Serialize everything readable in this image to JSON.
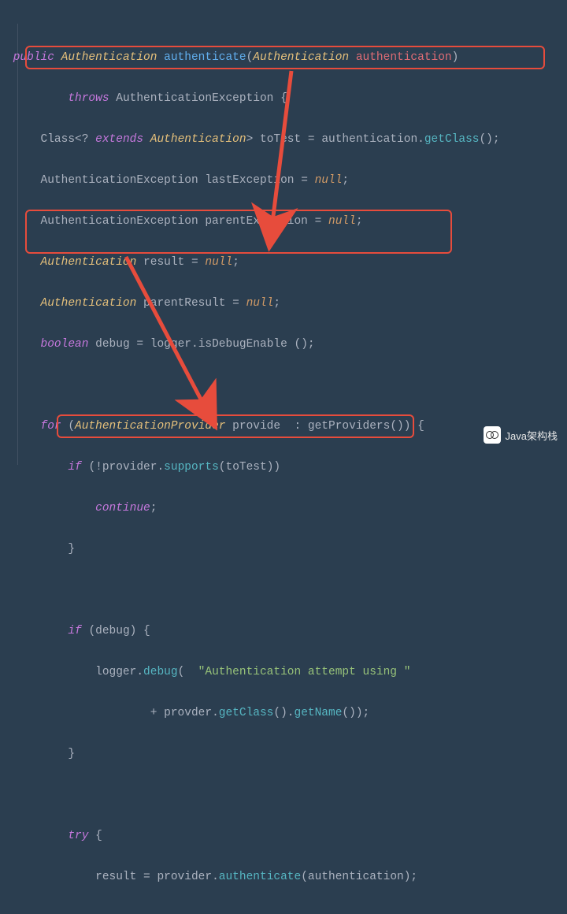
{
  "code": {
    "l1_public": "public",
    "l1_type": "Authentication",
    "l1_method": "authenticate",
    "l1_paramType": "Authentication",
    "l1_paramName": "authentication",
    "l2_throws": "throws",
    "l2_exType": "AuthenticationException",
    "l3_class": "Class",
    "l3_extends": "extends",
    "l3_authType": "Authentication",
    "l3_toTest": "toTest",
    "l3_auth": "authentication",
    "l3_getClass": "getClass",
    "l4_type": "AuthenticationException",
    "l4_var": "lastException",
    "l4_null": "null",
    "l5_type": "AuthenticationException",
    "l5_var": "parentException",
    "l5_null": "null",
    "l6_type": "Authentication",
    "l6_var": "result",
    "l6_null": "null",
    "l7_type": "Authentication",
    "l7_var": "parentResult",
    "l7_null": "null",
    "l8_bool": "boolean",
    "l8_var": "debug",
    "l8_logger": "logger",
    "l8_method": "isDebugEnable",
    "l10_for": "for",
    "l10_type": "AuthenticationProvider",
    "l10_var": "provide",
    "l10_getProviders": "getProviders",
    "l11_if": "if",
    "l11_provider": "provider",
    "l11_supports": "supports",
    "l11_toTest": "toTest",
    "l12_continue": "continue",
    "l15_if": "if",
    "l15_debug": "debug",
    "l16_logger": "logger",
    "l16_debug": "debug",
    "l16_str": "\"Authentication attempt using \"",
    "l17_provider": "provider",
    "l17_getClass": "getClass",
    "l17_getName": "getName",
    "l20_try": "try",
    "l21_result": "result",
    "l21_provider": "provider",
    "l21_authenticate": "authenticate",
    "l21_auth": "authentication"
  },
  "watermark": "Java架构栈"
}
